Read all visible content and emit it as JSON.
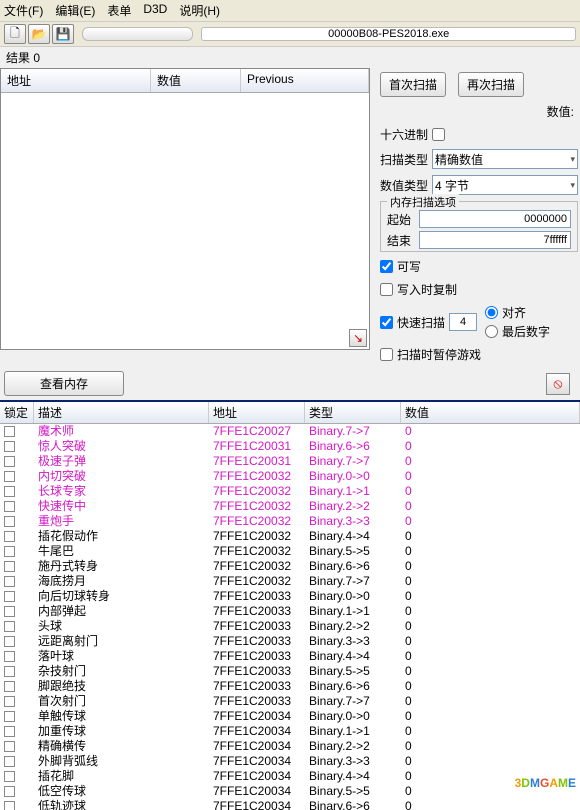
{
  "menu": {
    "items": [
      "文件(F)",
      "编辑(E)",
      "表单",
      "D3D",
      "说明(H)"
    ]
  },
  "process_name": "00000B08-PES2018.exe",
  "results_label": "结果 0",
  "list_head": {
    "addr": "地址",
    "val": "数值",
    "prev": "Previous"
  },
  "buttons": {
    "first_scan": "首次扫描",
    "next_scan": "再次扫描",
    "view_mem": "查看内存"
  },
  "scan": {
    "value_label": "数值:",
    "hex_label": "十六进制",
    "scan_type_label": "扫描类型",
    "scan_type_value": "精确数值",
    "value_type_label": "数值类型",
    "value_type_value": "4 字节",
    "mem_group_title": "内存扫描选项",
    "start_label": "起始",
    "start_value": "0000000",
    "stop_label": "结束",
    "stop_value": "7ffffff",
    "writable": "可写",
    "copy_on_write": "写入时复制",
    "fast_scan": "快速扫描",
    "fast_val": "4",
    "align": "对齐",
    "last_digits": "最后数字",
    "pause_on_scan": "扫描时暂停游戏"
  },
  "table_head": {
    "lock": "锁定",
    "desc": "描述",
    "addr": "地址",
    "type": "类型",
    "val": "数值"
  },
  "rows": [
    {
      "desc": "魔术师",
      "addr": "7FFE1C20027",
      "type": "Binary.7->7",
      "val": "0",
      "hl": true
    },
    {
      "desc": "惊人突破",
      "addr": "7FFE1C20031",
      "type": "Binary.6->6",
      "val": "0",
      "hl": true
    },
    {
      "desc": "极速子弹",
      "addr": "7FFE1C20031",
      "type": "Binary.7->7",
      "val": "0",
      "hl": true
    },
    {
      "desc": "内切突破",
      "addr": "7FFE1C20032",
      "type": "Binary.0->0",
      "val": "0",
      "hl": true
    },
    {
      "desc": "长球专家",
      "addr": "7FFE1C20032",
      "type": "Binary.1->1",
      "val": "0",
      "hl": true
    },
    {
      "desc": "快速传中",
      "addr": "7FFE1C20032",
      "type": "Binary.2->2",
      "val": "0",
      "hl": true
    },
    {
      "desc": "重炮手",
      "addr": "7FFE1C20032",
      "type": "Binary.3->3",
      "val": "0",
      "hl": true
    },
    {
      "desc": "插花假动作",
      "addr": "7FFE1C20032",
      "type": "Binary.4->4",
      "val": "0"
    },
    {
      "desc": "牛尾巴",
      "addr": "7FFE1C20032",
      "type": "Binary.5->5",
      "val": "0"
    },
    {
      "desc": "施丹式转身",
      "addr": "7FFE1C20032",
      "type": "Binary.6->6",
      "val": "0"
    },
    {
      "desc": "海底捞月",
      "addr": "7FFE1C20032",
      "type": "Binary.7->7",
      "val": "0"
    },
    {
      "desc": "向后切球转身",
      "addr": "7FFE1C20033",
      "type": "Binary.0->0",
      "val": "0"
    },
    {
      "desc": "内部弹起",
      "addr": "7FFE1C20033",
      "type": "Binary.1->1",
      "val": "0"
    },
    {
      "desc": "头球",
      "addr": "7FFE1C20033",
      "type": "Binary.2->2",
      "val": "0"
    },
    {
      "desc": "远距离射门",
      "addr": "7FFE1C20033",
      "type": "Binary.3->3",
      "val": "0"
    },
    {
      "desc": "落叶球",
      "addr": "7FFE1C20033",
      "type": "Binary.4->4",
      "val": "0"
    },
    {
      "desc": "杂技射门",
      "addr": "7FFE1C20033",
      "type": "Binary.5->5",
      "val": "0"
    },
    {
      "desc": "脚跟绝技",
      "addr": "7FFE1C20033",
      "type": "Binary.6->6",
      "val": "0"
    },
    {
      "desc": "首次射门",
      "addr": "7FFE1C20033",
      "type": "Binary.7->7",
      "val": "0"
    },
    {
      "desc": "单触传球",
      "addr": "7FFE1C20034",
      "type": "Binary.0->0",
      "val": "0"
    },
    {
      "desc": "加重传球",
      "addr": "7FFE1C20034",
      "type": "Binary.1->1",
      "val": "0"
    },
    {
      "desc": "精确横传",
      "addr": "7FFE1C20034",
      "type": "Binary.2->2",
      "val": "0"
    },
    {
      "desc": "外脚背弧线",
      "addr": "7FFE1C20034",
      "type": "Binary.3->3",
      "val": "0"
    },
    {
      "desc": "插花脚",
      "addr": "7FFE1C20034",
      "type": "Binary.4->4",
      "val": "0"
    },
    {
      "desc": "低空传球",
      "addr": "7FFE1C20034",
      "type": "Binary.5->5",
      "val": "0"
    },
    {
      "desc": "低轨迹球",
      "addr": "7FFE1C20034",
      "type": "Binary.6->6",
      "val": "0"
    }
  ],
  "watermark": "3DMGAME"
}
